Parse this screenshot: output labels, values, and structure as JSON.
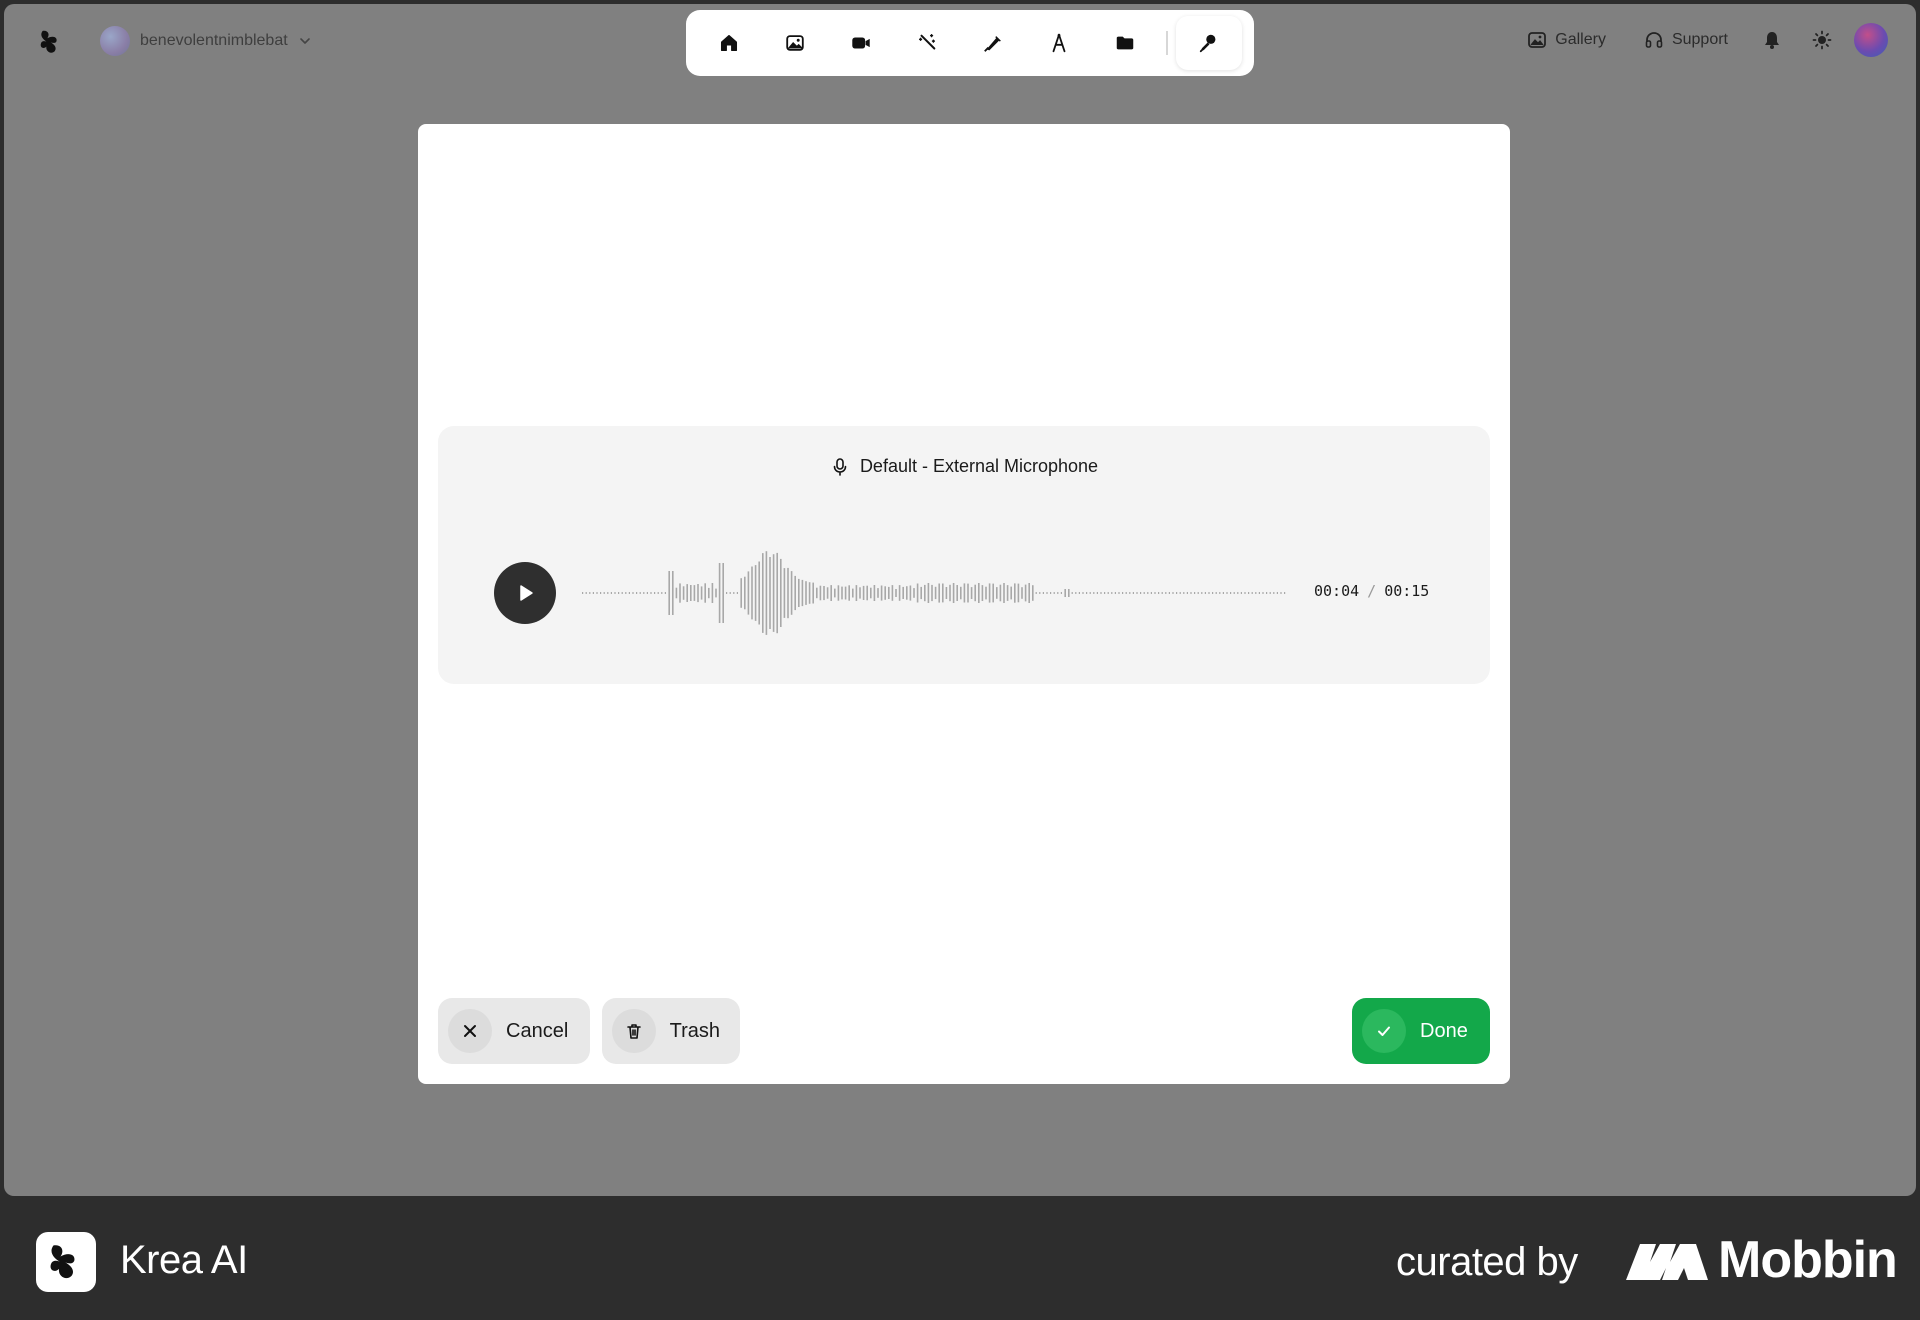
{
  "header": {
    "account_name": "benevolentnimblebat",
    "nav": {
      "gallery_label": "Gallery",
      "support_label": "Support"
    },
    "tools": [
      {
        "icon": "home-icon"
      },
      {
        "icon": "image-icon"
      },
      {
        "icon": "video-icon"
      },
      {
        "icon": "magic-wand-icon"
      },
      {
        "icon": "pen-brush-icon"
      },
      {
        "icon": "text-font-icon"
      },
      {
        "icon": "folder-icon"
      },
      {
        "icon": "microphone-icon",
        "active": true
      }
    ]
  },
  "recorder": {
    "device_label": "Default - External Microphone",
    "current_time": "00:04",
    "time_separator": "/",
    "total_time": "00:15",
    "progress_fraction": 0.27
  },
  "actions": {
    "cancel_label": "Cancel",
    "trash_label": "Trash",
    "done_label": "Done"
  },
  "brand": {
    "app_name": "Krea AI",
    "curated_by": "curated by",
    "curator": "Mobbin"
  },
  "colors": {
    "backdrop": "#808080",
    "done_green": "#13a84a",
    "waveform_gray": "#a8a8a8"
  }
}
